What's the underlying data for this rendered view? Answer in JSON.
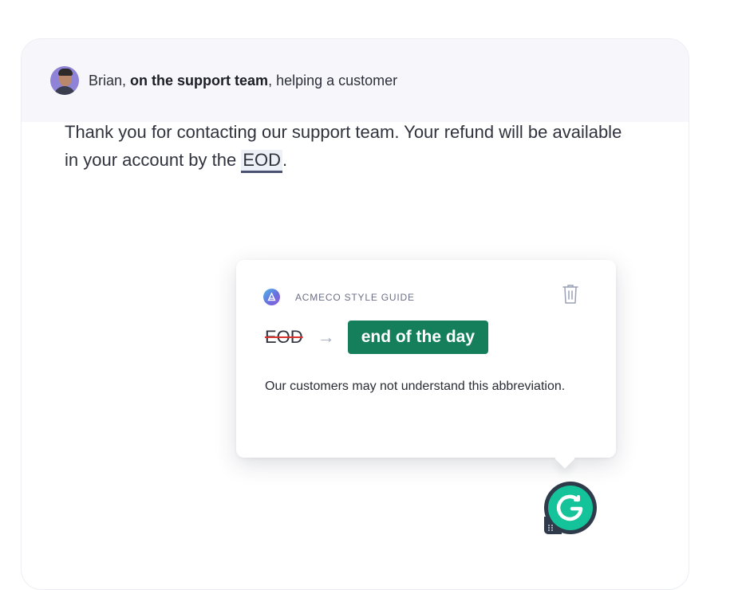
{
  "header": {
    "name": "Brian",
    "separator": ", ",
    "role": "on the support team",
    "context": ", helping a customer"
  },
  "message": {
    "text_before": "Thank you for contacting our support team. Your refund will be available in your account by the ",
    "flagged_word": "EOD",
    "text_after": "."
  },
  "suggestion_card": {
    "style_guide_label": "ACMECO STYLE GUIDE",
    "original": "EOD",
    "replacement": "end of the day",
    "explanation": "Our customers may not understand this abbreviation.",
    "arrow": "→"
  },
  "colors": {
    "accent_green": "#157e5a",
    "grammarly_green": "#15c39a",
    "strike_red": "#d9322e",
    "underline": "#4a5171"
  },
  "icons": [
    "avatar",
    "style-guide-logo-icon",
    "trash-icon",
    "arrow-right-icon",
    "grammarly-icon"
  ]
}
